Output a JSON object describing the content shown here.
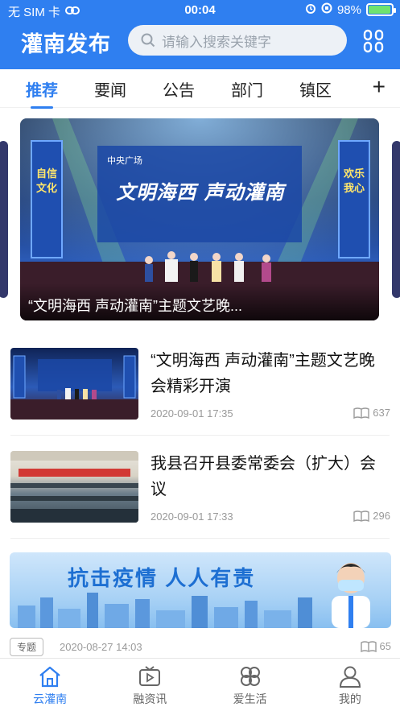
{
  "status_bar": {
    "carrier": "无 SIM 卡",
    "time": "00:04",
    "battery": "98%",
    "battery_level": 0.98
  },
  "header": {
    "brand": "灌南发布",
    "search_placeholder": "请输入搜索关键字"
  },
  "tabs": [
    {
      "label": "推荐",
      "active": true
    },
    {
      "label": "要闻",
      "active": false
    },
    {
      "label": "公告",
      "active": false
    },
    {
      "label": "部门",
      "active": false
    },
    {
      "label": "镇区",
      "active": false
    }
  ],
  "add_tab_label": "+",
  "banner": {
    "caption": "“文明海西 声动灌南”主题文艺晚...",
    "stage_title": "文明海西 声动灌南",
    "left_banner_text": "自信文化",
    "right_banner_text": "欢乐我心",
    "screen_header": "中央广场"
  },
  "news": [
    {
      "title": "“文明海西 声动灌南”主题文艺晚会精彩开演",
      "date": "2020-09-01 17:35",
      "reads": "637"
    },
    {
      "title": "我县召开县委常委会（扩大）会议",
      "date": "2020-09-01 17:33",
      "reads": "296"
    }
  ],
  "promo": {
    "slogan": "抗击疫情  人人有责",
    "tag": "专题",
    "date": "2020-08-27 14:03",
    "reads": "65"
  },
  "bottom_nav": [
    {
      "label": "云灌南",
      "icon": "home-icon",
      "active": true
    },
    {
      "label": "融资讯",
      "icon": "video-icon",
      "active": false
    },
    {
      "label": "爱生活",
      "icon": "clover-icon",
      "active": false
    },
    {
      "label": "我的",
      "icon": "user-icon",
      "active": false
    }
  ],
  "colors": {
    "brand_blue": "#2f7ff0",
    "text_dark": "#111111",
    "meta_gray": "#9a9a9a"
  }
}
